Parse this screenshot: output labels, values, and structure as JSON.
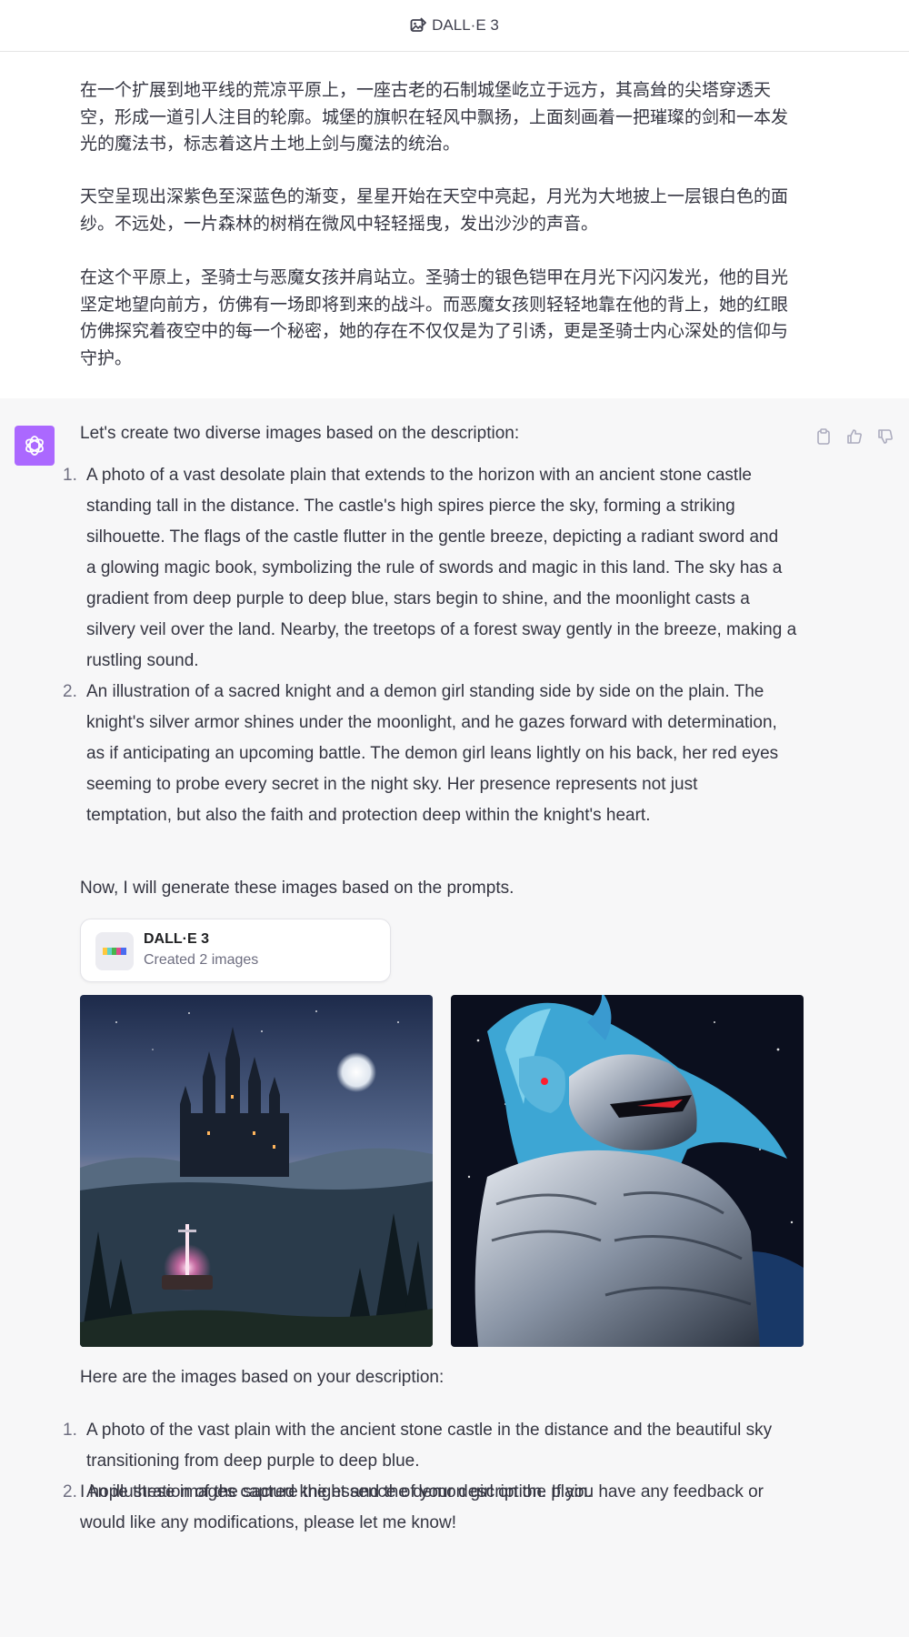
{
  "header": {
    "model_name": "DALL·E 3",
    "model_icon": "image-edit-icon"
  },
  "user_message": {
    "paragraphs": [
      "在一个扩展到地平线的荒凉平原上，一座古老的石制城堡屹立于远方，其高耸的尖塔穿透天空，形成一道引人注目的轮廓。城堡的旗帜在轻风中飘扬，上面刻画着一把璀璨的剑和一本发光的魔法书，标志着这片土地上剑与魔法的统治。",
      "天空呈现出深紫色至深蓝色的渐变，星星开始在天空中亮起，月光为大地披上一层银白色的面纱。不远处，一片森林的树梢在微风中轻轻摇曳，发出沙沙的声音。",
      "在这个平原上，圣骑士与恶魔女孩并肩站立。圣骑士的银色铠甲在月光下闪闪发光，他的目光坚定地望向前方，仿佛有一场即将到来的战斗。而恶魔女孩则轻轻地靠在他的背上，她的红眼仿佛探究着夜空中的每一个秘密，她的存在不仅仅是为了引诱，更是圣骑士内心深处的信仰与守护。"
    ]
  },
  "assistant": {
    "avatar_icon": "openai-logo-icon",
    "accent_color": "#ab68ff",
    "actions": [
      "copy-icon",
      "thumbs-up-icon",
      "thumbs-down-icon"
    ],
    "intro": "Let's create two diverse images based on the description:",
    "prompts": [
      {
        "num": "1.",
        "lines": [
          "A photo of a vast desolate plain that extends to the horizon with an ancient stone castle",
          "standing tall in the distance. The castle's high spires pierce the sky, forming a striking",
          "silhouette. The flags of the castle flutter in the gentle breeze, depicting a radiant sword and",
          "a glowing magic book, symbolizing the rule of swords and magic in this land. The sky has a",
          "gradient from deep purple to deep blue, stars begin to shine, and the moonlight casts a",
          "silvery veil over the land. Nearby, the treetops of a forest sway gently in the breeze, making a",
          "rustling sound."
        ]
      },
      {
        "num": "2.",
        "lines": [
          "An illustration of a sacred knight and a demon girl standing side by side on the plain. The",
          "knight's silver armor shines under the moonlight, and he gazes forward with determination,",
          "as if anticipating an upcoming battle. The demon girl leans lightly on his back, her red eyes",
          "seeming to probe every secret in the night sky. Her presence represents not just",
          "temptation, but also the faith and protection deep within the knight's heart."
        ]
      }
    ],
    "now": "Now, I will generate these images based on the prompts.",
    "dalle_card": {
      "title": "DALL·E 3",
      "subtitle": "Created 2 images"
    },
    "here": "Here are the images based on your description:",
    "summary": [
      {
        "num": "1.",
        "lines": [
          "A photo of the vast plain with the ancient stone castle in the distance and the beautiful sky",
          "transitioning from deep purple to deep blue."
        ]
      },
      {
        "num": "2.",
        "lines": [
          "An illustration of the sacred knight and the demon girl on the plain."
        ]
      }
    ],
    "closing": [
      "I hope these images capture the essence of your description. If you have any feedback or",
      "would like any modifications, please let me know!"
    ]
  }
}
